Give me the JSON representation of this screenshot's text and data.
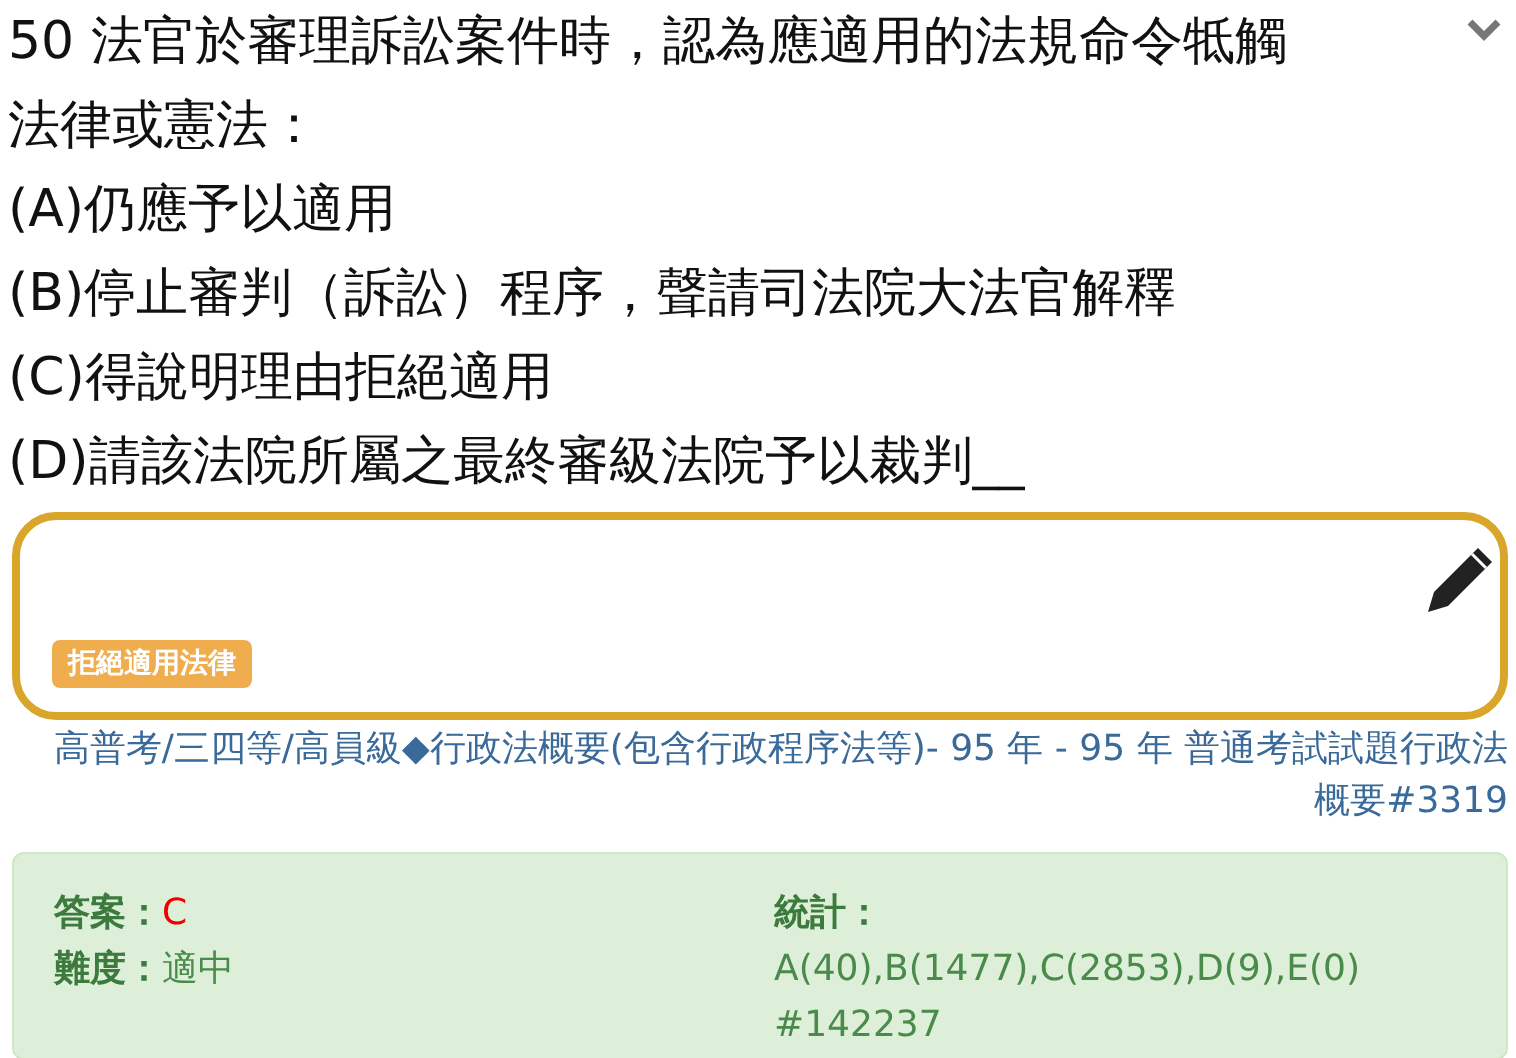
{
  "question": {
    "text": "50 法官於審理訴訟案件時，認為應適用的法規命令牴觸法律或憲法：",
    "expanded": false
  },
  "options": [
    "(A)仍應予以適用",
    "(B)停止審判（訴訟）程序，聲請司法院大法官解釋",
    "(C)得說明理由拒絕適用",
    "(D)請該法院所屬之最終審級法院予以裁判__"
  ],
  "note": {
    "tags": [
      "拒絕適用法律"
    ]
  },
  "source": "高普考/三四等/高員級◆行政法概要(包含行政程序法等)- 95 年 - 95 年 普通考試試題行政法概要#3319",
  "answer": {
    "label": "答案：",
    "value": "C"
  },
  "difficulty": {
    "label": "難度：",
    "value": "適中"
  },
  "stats": {
    "label": "統計：",
    "value": "A(40),B(1477),C(2853),D(9),E(0)",
    "id": "#142237"
  }
}
